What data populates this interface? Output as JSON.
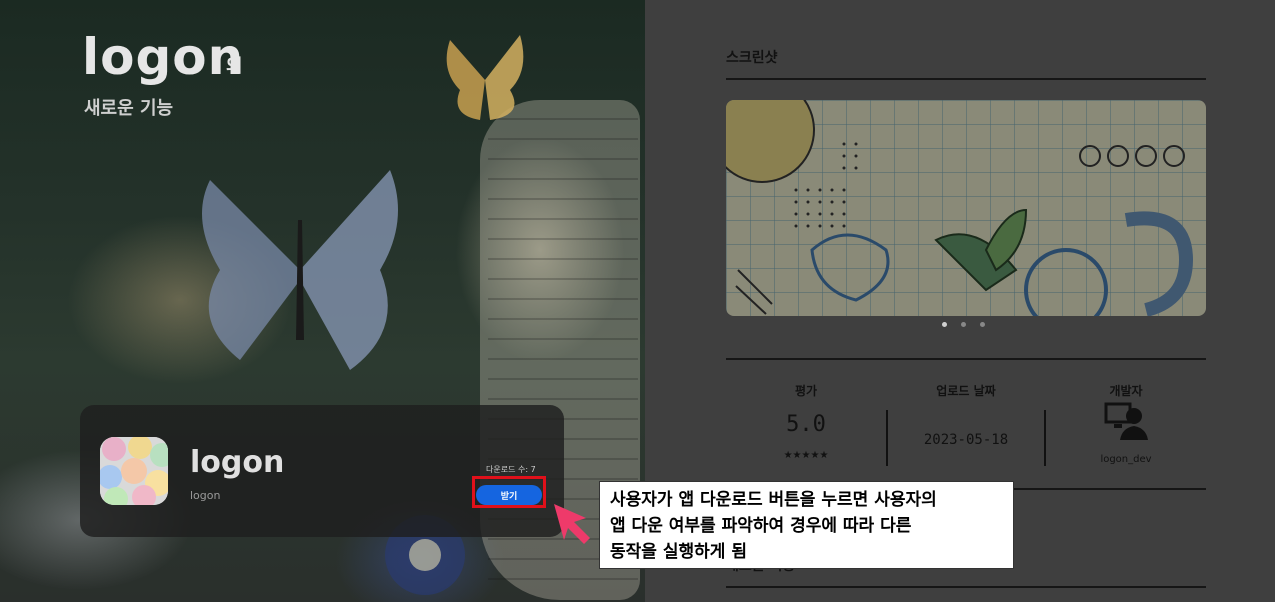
{
  "hero": {
    "title": "logon",
    "title_suffix": "의",
    "subtitle": "새로운 기능"
  },
  "app": {
    "name": "logon",
    "developer": "logon",
    "download_count": "다운로드 수: 7",
    "get_button": "받기"
  },
  "panel": {
    "screenshots_title": "스크린샷",
    "carousel_page_count": 3,
    "carousel_active_index": 0,
    "rating_label": "평가",
    "rating_value": "5.0",
    "rating_stars": "★★★★★",
    "upload_date_label": "업로드 날짜",
    "upload_date": "2023-05-18",
    "developer_label": "개발자",
    "developer_name": "logon_dev",
    "bottom_section_title": "새로운 기능"
  },
  "annotation": {
    "line1": "사용자가 앱 다운로드 버튼을 누르면 사용자의",
    "line2": "앱 다운 여부를 파악하여 경우에 따라 다른",
    "line3": "동작을 실행하게 됨"
  },
  "colors": {
    "accent_button": "#1565e0",
    "highlight_border": "#e0101a",
    "arrow": "#ee3a6a"
  }
}
